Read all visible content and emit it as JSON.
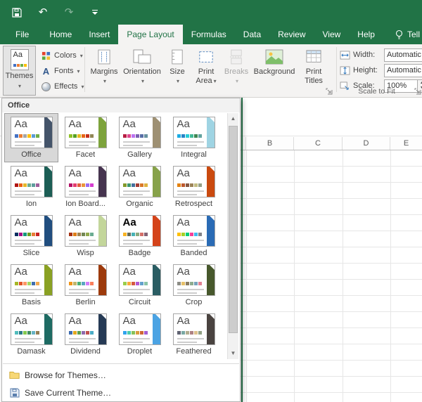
{
  "app": {
    "accent_color": "#217346"
  },
  "titlebar": {
    "icons": [
      {
        "name": "save-icon"
      },
      {
        "name": "undo-icon",
        "glyph": "↶"
      },
      {
        "name": "redo-icon",
        "glyph": "↷",
        "disabled": true
      },
      {
        "name": "customize-quick-access-icon"
      }
    ]
  },
  "tabs": [
    {
      "label": "File",
      "file": true
    },
    {
      "label": "Home"
    },
    {
      "label": "Insert"
    },
    {
      "label": "Page Layout",
      "selected": true
    },
    {
      "label": "Formulas"
    },
    {
      "label": "Data"
    },
    {
      "label": "Review"
    },
    {
      "label": "View"
    },
    {
      "label": "Help"
    },
    {
      "label": "Tell me w",
      "tellme": true
    }
  ],
  "ribbon": {
    "themes_group": {
      "themes": {
        "label": "Themes"
      },
      "colors": {
        "label": "Colors"
      },
      "fonts": {
        "label": "Fonts"
      },
      "effects": {
        "label": "Effects"
      }
    },
    "page_setup": {
      "margins": {
        "line1": "Margins",
        "line2": ""
      },
      "orientation": {
        "line1": "Orientation",
        "line2": ""
      },
      "size": {
        "line1": "Size",
        "line2": ""
      },
      "print_area": {
        "line1": "Print",
        "line2": "Area"
      },
      "breaks": {
        "line1": "Breaks",
        "line2": ""
      },
      "background": {
        "line1": "Background",
        "line2": ""
      },
      "print_titles": {
        "line1": "Print",
        "line2": "Titles"
      }
    },
    "scale_to_fit": {
      "width_label": "Width:",
      "width_value": "Automatic",
      "height_label": "Height:",
      "height_value": "Automatic",
      "scale_label": "Scale:",
      "scale_value": "100%",
      "group_label": "Scale to Fit"
    }
  },
  "themes_dropdown": {
    "header": "Office",
    "thumb_text": "Aa",
    "browse_label": "Browse for Themes…",
    "save_label": "Save Current Theme…",
    "items": [
      {
        "name": "Office",
        "selected": true,
        "stripe": "#44546a",
        "colors": [
          "#4472c4",
          "#ed7d31",
          "#a5a5a5",
          "#ffc000",
          "#5b9bd5",
          "#70ad47"
        ]
      },
      {
        "name": "Facet",
        "stripe": "#7da33c",
        "colors": [
          "#90c226",
          "#54a021",
          "#e6b91e",
          "#e76618",
          "#c42f1a",
          "#918655"
        ]
      },
      {
        "name": "Gallery",
        "stripe": "#9e9073",
        "colors": [
          "#b71e42",
          "#de478e",
          "#bc72f0",
          "#795faf",
          "#586ea6",
          "#6892a0"
        ]
      },
      {
        "name": "Integral",
        "stripe": "#9fd4e3",
        "colors": [
          "#1cade4",
          "#2683c6",
          "#27ced7",
          "#42ba97",
          "#3e8853",
          "#62a39f"
        ]
      },
      {
        "name": "Ion",
        "stripe": "#1c5e55",
        "colors": [
          "#b01513",
          "#ea6312",
          "#e6b729",
          "#6aac90",
          "#5f9c9d",
          "#9e5e9b"
        ]
      },
      {
        "name": "Ion Board...",
        "stripe": "#46344f",
        "colors": [
          "#b31166",
          "#e33d6f",
          "#e45f3c",
          "#e9943a",
          "#9b6bf2",
          "#d53dd0"
        ]
      },
      {
        "name": "Organic",
        "stripe": "#87a24a",
        "colors": [
          "#83992a",
          "#3c9770",
          "#44709d",
          "#a23c33",
          "#d97828",
          "#deb340"
        ]
      },
      {
        "name": "Retrospect",
        "stripe": "#ca4a0f",
        "colors": [
          "#e48312",
          "#bd582c",
          "#865640",
          "#9b8357",
          "#c2bc80",
          "#94a088"
        ]
      },
      {
        "name": "Slice",
        "stripe": "#214e7f",
        "colors": [
          "#052f61",
          "#a50e82",
          "#14967c",
          "#6a9e1f",
          "#e87d37",
          "#c62324"
        ]
      },
      {
        "name": "Wisp",
        "stripe": "#c3d69b",
        "colors": [
          "#a53010",
          "#de7e18",
          "#9f8351",
          "#728653",
          "#92aa4c",
          "#6aac91"
        ]
      },
      {
        "name": "Badge",
        "stripe": "#d4431a",
        "aa_bold": true,
        "colors": [
          "#f8b323",
          "#656a59",
          "#46b2b5",
          "#8caa7e",
          "#d36f68",
          "#826276"
        ]
      },
      {
        "name": "Banded",
        "stripe": "#2a6bb5",
        "colors": [
          "#ffc000",
          "#a5d028",
          "#08cc78",
          "#f24099",
          "#3ebbf0",
          "#828288"
        ]
      },
      {
        "name": "Basis",
        "stripe": "#8aa123",
        "colors": [
          "#a6b727",
          "#df5327",
          "#fe9666",
          "#a5d75f",
          "#3f6fad",
          "#f1a94e"
        ]
      },
      {
        "name": "Berlin",
        "stripe": "#9d3a0c",
        "colors": [
          "#f09415",
          "#c1b56b",
          "#4baf73",
          "#5aa6c0",
          "#d17df9",
          "#fa7e5c"
        ]
      },
      {
        "name": "Circuit",
        "stripe": "#2a5d63",
        "colors": [
          "#9acd4c",
          "#faa93a",
          "#d35940",
          "#b258d3",
          "#63a0cc",
          "#8ac4a7"
        ]
      },
      {
        "name": "Crop",
        "stripe": "#47582c",
        "colors": [
          "#8c8d86",
          "#e6c069",
          "#897b61",
          "#8dab8e",
          "#77a2bb",
          "#e28394"
        ]
      },
      {
        "name": "Damask",
        "stripe": "#1e6b63",
        "colors": [
          "#52bdbd",
          "#2a7b88",
          "#84c94f",
          "#3e8d5e",
          "#66b2c4",
          "#937e53"
        ]
      },
      {
        "name": "Dividend",
        "stripe": "#263a55",
        "colors": [
          "#3b6bb0",
          "#e3a820",
          "#5b9e4d",
          "#8e6aad",
          "#c0504d",
          "#4bacc6"
        ]
      },
      {
        "name": "Droplet",
        "stripe": "#4ba3e3",
        "colors": [
          "#2fa3ee",
          "#4bcaad",
          "#86c157",
          "#d99c3f",
          "#ce6633",
          "#a35dd1"
        ]
      },
      {
        "name": "Feathered",
        "stripe": "#4a4340",
        "colors": [
          "#606372",
          "#79a8a4",
          "#b2ad8f",
          "#ad8082",
          "#dec18c",
          "#92a185"
        ]
      }
    ]
  },
  "worksheet": {
    "columns": [
      "B",
      "C",
      "D",
      "E"
    ]
  }
}
